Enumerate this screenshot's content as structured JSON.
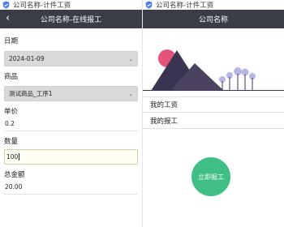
{
  "left": {
    "wechat_title": "公司名称-计件工资",
    "nav_title": "公司名称-在线报工",
    "fields": {
      "date": {
        "label": "日期",
        "value": "2024-01-09"
      },
      "product": {
        "label": "商品",
        "value": "测试商品_工序1"
      },
      "price": {
        "label": "单价",
        "value": "0.2"
      },
      "quantity": {
        "label": "数量",
        "value": "100"
      },
      "total": {
        "label": "总金额",
        "value": "20.00"
      }
    }
  },
  "right": {
    "wechat_title": "公司名称-计件工资",
    "nav_title": "公司名称",
    "menu": [
      "我的工资",
      "我的报工"
    ],
    "report_button": "立即报工"
  },
  "icons": {
    "back": "back-arrow-icon",
    "shield": "shield-icon",
    "chevron": "chevron-down-icon"
  },
  "colors": {
    "navbar": "#3a3d46",
    "accent_green": "#3fbf86",
    "select_bg": "#d9d9d9"
  }
}
